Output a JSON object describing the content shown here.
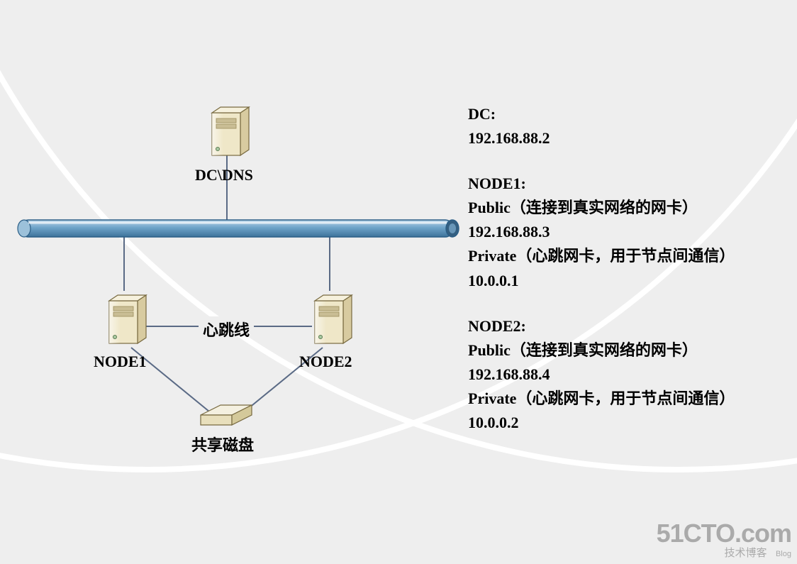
{
  "diagram": {
    "dc_label": "DC\\DNS",
    "node1_label": "NODE1",
    "node2_label": "NODE2",
    "heartbeat_label": "心跳线",
    "disk_label": "共享磁盘"
  },
  "info": {
    "dc_title": "DC:",
    "dc_ip": "192.168.88.2",
    "node1_title": "NODE1:",
    "node1_public": "Public（连接到真实网络的网卡）",
    "node1_public_ip": "192.168.88.3",
    "node1_private": "Private（心跳网卡，用于节点间通信）",
    "node1_private_ip": "10.0.0.1",
    "node2_title": "NODE2:",
    "node2_public": "Public（连接到真实网络的网卡）",
    "node2_public_ip": "192.168.88.4",
    "node2_private": "Private（心跳网卡，用于节点间通信）",
    "node2_private_ip": "10.0.0.2"
  },
  "watermark": {
    "logo": "51CTO.com",
    "sub": "技术博客",
    "tag": "Blog"
  }
}
